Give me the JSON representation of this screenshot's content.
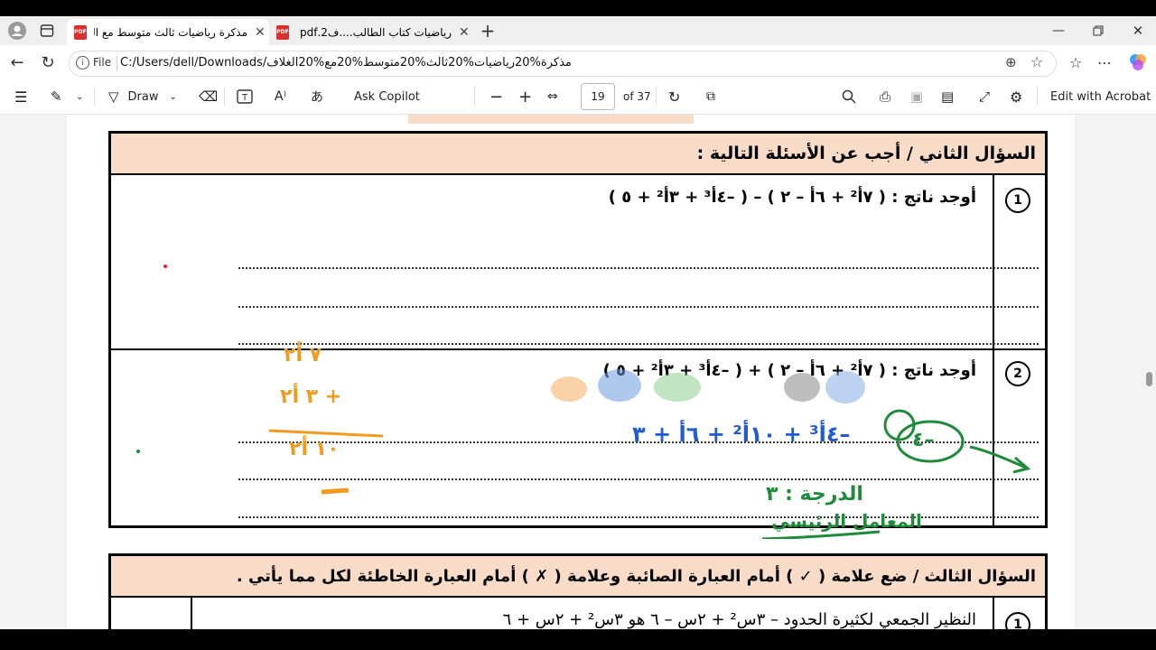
{
  "tabs": [
    {
      "label": "مذكرة رياضيات ثالث متوسط مع الغ",
      "icon": "pdf-icon",
      "active": true
    },
    {
      "label": "رياضيات كتاب الطالب....ف2.pdf",
      "icon": "pdf-icon",
      "active": false
    }
  ],
  "address": {
    "scheme_label": "File",
    "url": "C:/Users/dell/Downloads/مذكرة%20رياضيات%20ثالث%20متوسط%20مع%20الغلاف.pdf"
  },
  "toolbar": {
    "draw_label": "Draw",
    "ask_copilot_label": "Ask Copilot",
    "page_number": "19",
    "page_total": "of 37",
    "edit_acrobat_label": "Edit with Acrobat"
  },
  "document": {
    "q2_header": "السؤال الثاني / أجب عن الأسئلة التالية :",
    "item1_num": "1",
    "item1_text": "أوجد ناتج : ( ٧أ² + ٦أ – ٢ ) – ( –٤أ³ + ٣أ² + ٥ )",
    "item2_num": "2",
    "item2_text": "أوجد ناتج : ( ٧أ² + ٦أ – ٢ ) + ( –٤أ³ + ٣أ² + ٥ )",
    "q3_header": "السؤال الثالث / ضع علامة ( ✓ )  أمام العبارة الصائبة وعلامة  ( ✗ )  أمام العبارة الخاطئة لكل مما يأتي .",
    "q3_item1_num": "1",
    "q3_item1_text": "النظير الجمعي لكثيرة الحدود   – ٣س² + ٢س – ٦   هو   ٣س² + ٢س + ٦"
  },
  "annotations": {
    "orange_work": [
      "٧ أ٢",
      "+ ٣ أ٢",
      "١٠ أ٢"
    ],
    "handwritten_answer": "–٤أ³ + ١٠أ² + ٦أ + ٣",
    "degree_note": "الدرجة : ٣",
    "leading_coef_note": "المعامل الرئيسي",
    "circled_coef": "–٤"
  },
  "colors": {
    "header_bg": "#f9dcc8",
    "ink_blue": "#1f5bd1",
    "ink_orange": "#f39a1e",
    "ink_green": "#1e8a3a"
  }
}
